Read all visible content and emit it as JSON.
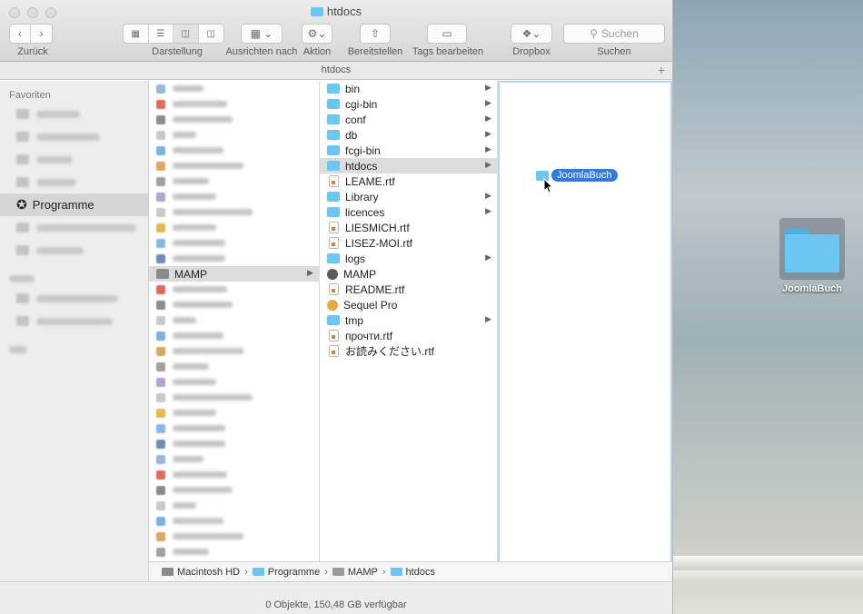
{
  "window": {
    "title": "htdocs",
    "path_title": "htdocs",
    "status": "0 Objekte, 150,48 GB verfügbar"
  },
  "toolbar": {
    "back_label": "Zurück",
    "view_label": "Darstellung",
    "arrange_label": "Ausrichten nach",
    "action_label": "Aktion",
    "share_label": "Bereitstellen",
    "tags_label": "Tags bearbeiten",
    "dropbox_label": "Dropbox",
    "search_label": "Suchen",
    "search_placeholder": "Suchen"
  },
  "sidebar": {
    "favorites_header": "Favoriten",
    "selected_item": "Programme"
  },
  "column1": {
    "selected": "MAMP"
  },
  "column2": {
    "items": [
      {
        "label": "bin",
        "icon": "folder",
        "arrow": true
      },
      {
        "label": "cgi-bin",
        "icon": "folder",
        "arrow": true
      },
      {
        "label": "conf",
        "icon": "folder",
        "arrow": true
      },
      {
        "label": "db",
        "icon": "folder",
        "arrow": true
      },
      {
        "label": "fcgi-bin",
        "icon": "folder",
        "arrow": true
      },
      {
        "label": "htdocs",
        "icon": "folder",
        "arrow": true,
        "selected": true
      },
      {
        "label": "LEAME.rtf",
        "icon": "rtf",
        "arrow": false
      },
      {
        "label": "Library",
        "icon": "folder",
        "arrow": true
      },
      {
        "label": "licences",
        "icon": "folder",
        "arrow": true
      },
      {
        "label": "LIESMICH.rtf",
        "icon": "rtf",
        "arrow": false
      },
      {
        "label": "LISEZ-MOI.rtf",
        "icon": "rtf",
        "arrow": false
      },
      {
        "label": "logs",
        "icon": "folder",
        "arrow": true
      },
      {
        "label": "MAMP",
        "icon": "app",
        "arrow": false
      },
      {
        "label": "README.rtf",
        "icon": "rtf",
        "arrow": false
      },
      {
        "label": "Sequel Pro",
        "icon": "app2",
        "arrow": false
      },
      {
        "label": "tmp",
        "icon": "folder",
        "arrow": true
      },
      {
        "label": "прочти.rtf",
        "icon": "rtf",
        "arrow": false
      },
      {
        "label": "お読みください.rtf",
        "icon": "rtf",
        "arrow": false
      }
    ]
  },
  "drag": {
    "label": "JoomlaBuch"
  },
  "breadcrumb": {
    "items": [
      "Macintosh HD",
      "Programme",
      "MAMP",
      "htdocs"
    ]
  },
  "desktop": {
    "icon_label": "JoomlaBuch"
  },
  "colors": {
    "folder": "#6cc6f1",
    "selection": "#2f7ae5"
  }
}
